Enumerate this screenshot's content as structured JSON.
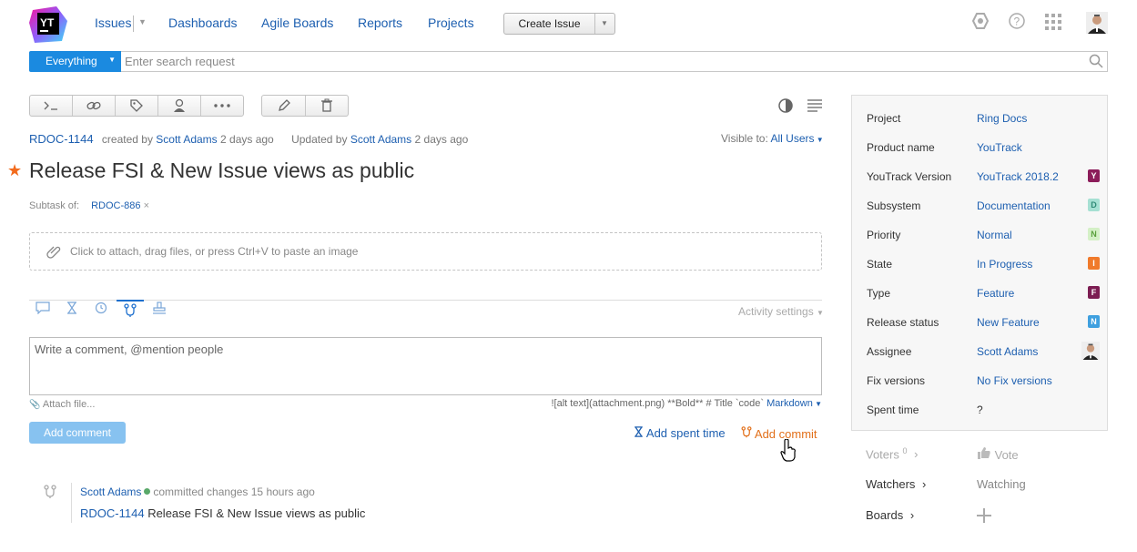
{
  "app": {
    "logo_text": "YT",
    "nav": [
      "Issues",
      "Dashboards",
      "Agile Boards",
      "Reports",
      "Projects"
    ],
    "create_issue": "Create Issue"
  },
  "search": {
    "context": "Everything",
    "placeholder": "Enter search request"
  },
  "issue": {
    "id": "RDOC-1144",
    "created_by_prefix": "created by",
    "author": "Scott Adams",
    "created_ago": "2 days ago",
    "updated_prefix": "Updated by",
    "updated_by": "Scott Adams",
    "updated_ago": "2 days ago",
    "visible_to_label": "Visible to:",
    "visible_to": "All Users",
    "title": "Release FSI & New Issue views as public",
    "subtask_label": "Subtask of:",
    "subtask_id": "RDOC-886",
    "dropzone_text": "Click to attach, drag files, or press Ctrl+V to paste an image"
  },
  "activity": {
    "settings_label": "Activity settings",
    "comment_placeholder": "Write a comment, @mention people",
    "attach_file": "Attach file...",
    "markdown_hint": "![alt text](attachment.png) **Bold** # Title `code`",
    "markdown_link": "Markdown",
    "add_comment": "Add comment",
    "add_spent_time": "Add spent time",
    "add_commit": "Add commit",
    "commit_author": "Scott Adams",
    "commit_text": "committed changes 15 hours ago",
    "commit_issue": "RDOC-1144",
    "commit_message": "Release FSI & New Issue views as public"
  },
  "fields": [
    {
      "label": "Project",
      "value": "Ring Docs",
      "badge": ""
    },
    {
      "label": "Product name",
      "value": "YouTrack",
      "badge": ""
    },
    {
      "label": "YouTrack Version",
      "value": "YouTrack 2018.2",
      "badge": "Y",
      "badge_bg": "#8c1d5a",
      "badge_fg": "#ffffff"
    },
    {
      "label": "Subsystem",
      "value": "Documentation",
      "badge": "D",
      "badge_bg": "#a6e0d3",
      "badge_fg": "#2f8a76"
    },
    {
      "label": "Priority",
      "value": "Normal",
      "badge": "N",
      "badge_bg": "#d4f0c6",
      "badge_fg": "#5aa03c"
    },
    {
      "label": "State",
      "value": "In Progress",
      "badge": "I",
      "badge_bg": "#f07a2b",
      "badge_fg": "#ffffff"
    },
    {
      "label": "Type",
      "value": "Feature",
      "badge": "F",
      "badge_bg": "#7c1d52",
      "badge_fg": "#ffffff"
    },
    {
      "label": "Release status",
      "value": "New Feature",
      "badge": "N",
      "badge_bg": "#3fa0df",
      "badge_fg": "#ffffff"
    },
    {
      "label": "Assignee",
      "value": "Scott Adams",
      "badge": ""
    },
    {
      "label": "Fix versions",
      "value": "No Fix versions",
      "badge": ""
    },
    {
      "label": "Spent time",
      "value": "?",
      "badge": ""
    }
  ],
  "extras": {
    "voters_label": "Voters",
    "voters_count": "0",
    "vote": "Vote",
    "watchers_label": "Watchers",
    "watching": "Watching",
    "boards_label": "Boards"
  }
}
